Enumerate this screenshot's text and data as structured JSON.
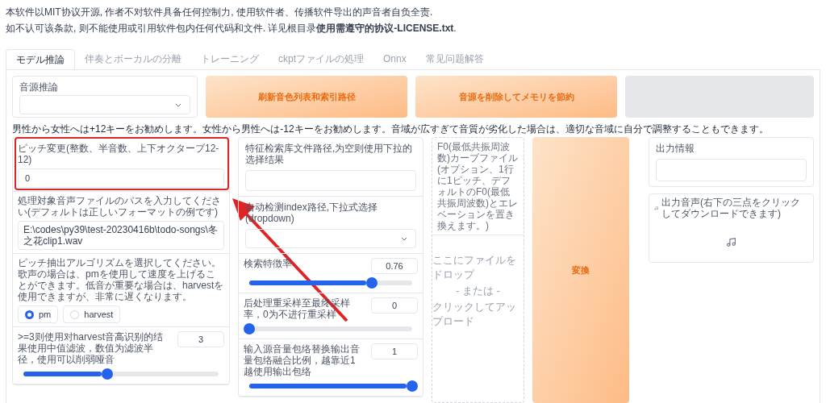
{
  "notice": {
    "lines": [
      "本软件以MIT协议开源, 作者不对软件具备任何控制力, 使用软件者、传播软件导出的声音者自负全责.",
      "如不认可该条款, 则不能使用或引用软件包内任何代码和文件. 详见根目录**使用需遵守的协议-LICENSE.txt**."
    ]
  },
  "tabs": [
    {
      "label": "モデル推論",
      "selected": true
    },
    {
      "label": "伴奏とボーカルの分離",
      "selected": false
    },
    {
      "label": "トレーニング",
      "selected": false
    },
    {
      "label": "ckptファイルの処理",
      "selected": false
    },
    {
      "label": "Onnx",
      "selected": false
    },
    {
      "label": "常见问题解答",
      "selected": false
    }
  ],
  "voice_select": {
    "label": "音源推論"
  },
  "top_buttons": [
    "刷新音色列表和索引路径",
    "音源を削除してメモリを節約"
  ],
  "hint": "男性から女性へは+12キーをお勧めします。女性から男性へは-12キーをお勧めします。音域が広すぎて音質が劣化した場合は、適切な音域に自分で調整することもできます。",
  "pitch": {
    "label": "ピッチ変更(整数、半音数、上下オクターブ12-12)",
    "value": "0"
  },
  "input_path": {
    "label": "処理対象音声ファイルのパスを入力してください(デフォルトは正しいフォーマットの例です)",
    "value": "E:\\codes\\py39\\test-20230416b\\todo-songs\\冬之花clip1.wav"
  },
  "f0_method": {
    "label": "ピッチ抽出アルゴリズムを選択してください。歌声の場合は、pmを使用して速度を上げることができます。低音が重要な場合は、harvestを使用できますが、非常に遅くなります。",
    "options": [
      {
        "label": "pm",
        "selected": true
      },
      {
        "label": "harvest",
        "selected": false
      }
    ]
  },
  "filter_radius": {
    "label": ">=3则使用对harvest音高识别的结果使用中值滤波，数值为滤波半径，使用可以削弱哑音",
    "value": "3",
    "level": 0.43
  },
  "index_path": {
    "label": "特征检索库文件路径,为空则使用下拉的选择结果"
  },
  "auto_index": {
    "label": "自动检测index路径,下拉式选择(dropdown)"
  },
  "index_rate": {
    "label": "検索特徴率",
    "value": "0.76",
    "level": 0.75
  },
  "resample": {
    "label": "后处理重采样至最终采样率，0为不进行重采样",
    "value": "0",
    "level": 0
  },
  "envelope": {
    "label": "输入源音量包络替换输出音量包络融合比例，越靠近1越使用输出包络",
    "value": "1",
    "level": 1
  },
  "f0_file": {
    "label": "F0(最低共振周波数)カーブファイル(オプション、1行に1ピッチ、デフォルトのF0(最低共振周波数)とエレベーションを置き換えます。)",
    "drop_text": [
      "ここにファイルをドロップ",
      "- または -",
      "クリックしてアップロード"
    ]
  },
  "convert_button": "変換",
  "output_info": {
    "label": "出力情報"
  },
  "output_audio": {
    "label": "出力音声(右下の三点をクリックしてダウンロードできます)"
  }
}
